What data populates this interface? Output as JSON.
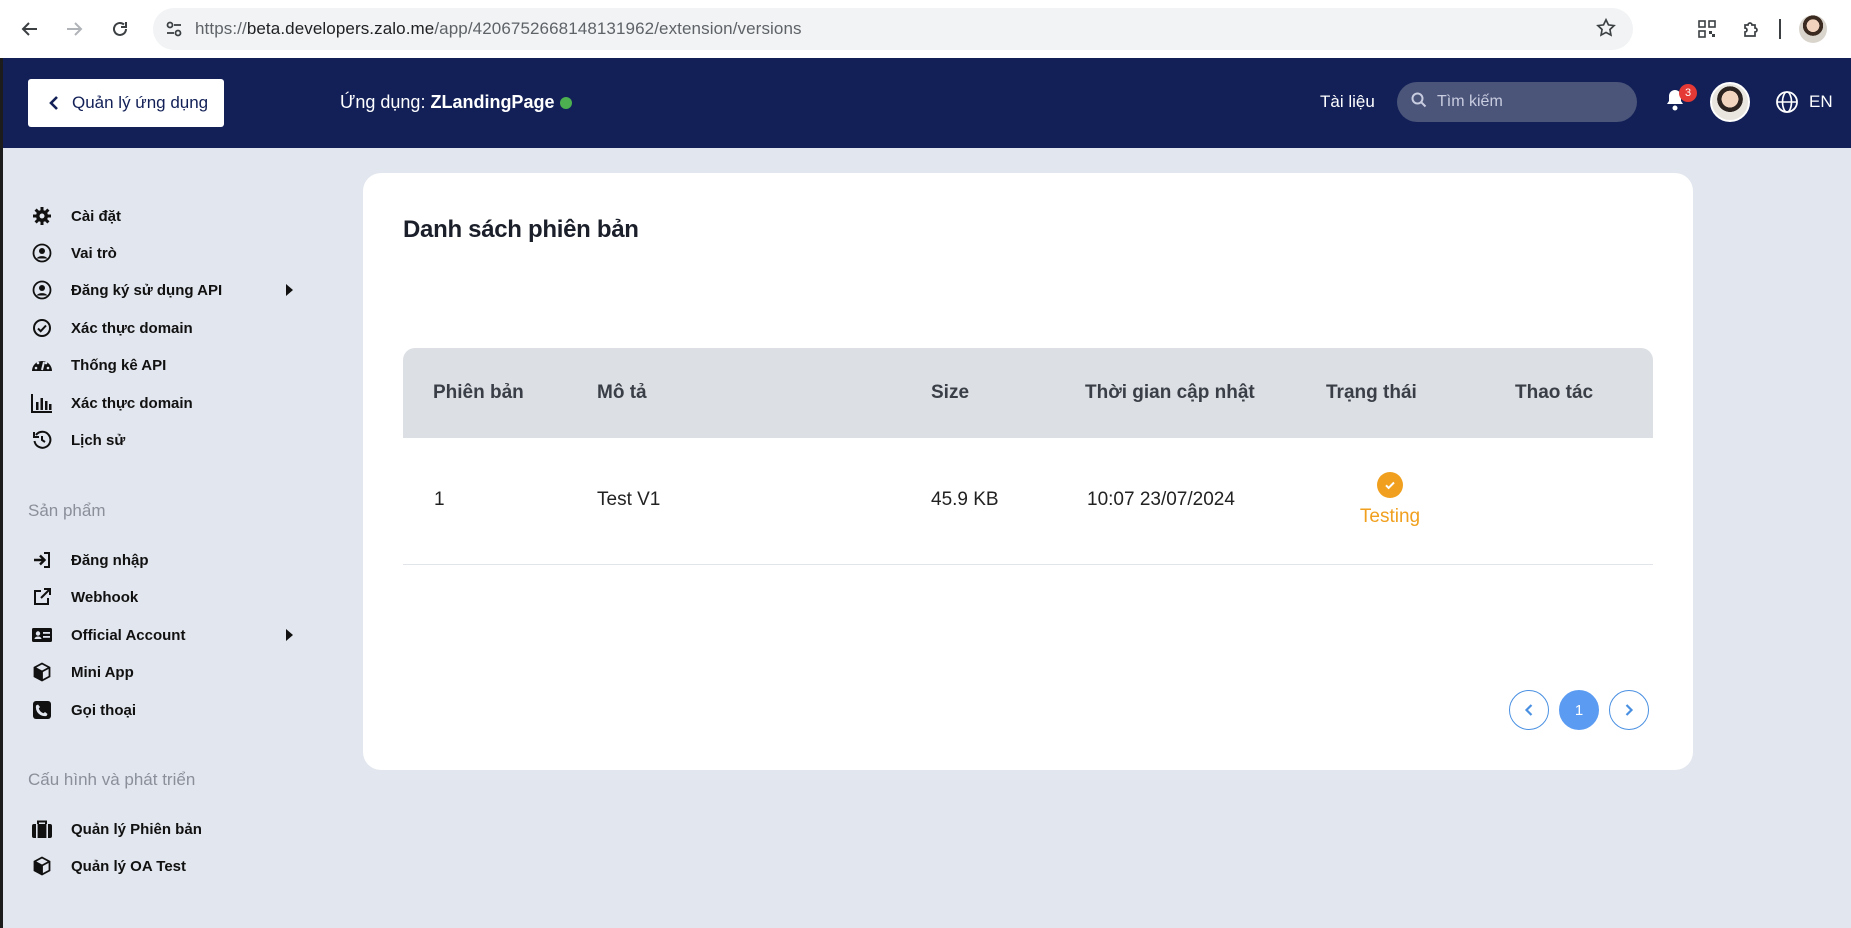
{
  "browser": {
    "url_prefix": "https://",
    "url_host": "beta.developers.zalo.me",
    "url_path": "/app/4206752668148131962/extension/versions"
  },
  "header": {
    "back_label": "Quản lý ứng dụng",
    "app_prefix": "Ứng dụng:",
    "app_name": "ZLandingPage",
    "app_status_color": "#4cb050",
    "docs_label": "Tài liệu",
    "search_placeholder": "Tìm kiếm",
    "notification_count": "3",
    "language": "EN"
  },
  "sidebar": {
    "items": [
      {
        "label": "Cài đặt",
        "icon": "gear-icon"
      },
      {
        "label": "Vai trò",
        "icon": "user-circle-icon"
      },
      {
        "label": "Đăng ký sử dụng API",
        "icon": "user-circle-icon"
      },
      {
        "label": "Xác thực domain",
        "icon": "check-circle-icon"
      },
      {
        "label": "Thống kê API",
        "icon": "gauge-icon"
      },
      {
        "label": "Xác thực domain",
        "icon": "bar-chart-icon"
      },
      {
        "label": "Lịch sử",
        "icon": "history-icon"
      }
    ],
    "section_products": "Sản phẩm",
    "product_items": [
      {
        "label": "Đăng nhập",
        "icon": "sign-in-icon"
      },
      {
        "label": "Webhook",
        "icon": "external-link-icon"
      },
      {
        "label": "Official Account",
        "icon": "id-card-icon"
      },
      {
        "label": "Mini App",
        "icon": "cube-icon"
      },
      {
        "label": "Gọi thoại",
        "icon": "phone-icon"
      }
    ],
    "section_config": "Cấu hình và phát triển",
    "config_items": [
      {
        "label": "Quản lý Phiên bản",
        "icon": "briefcase-icon"
      },
      {
        "label": "Quản lý OA Test",
        "icon": "cube-icon"
      }
    ]
  },
  "main": {
    "title": "Danh sách phiên bản",
    "columns": [
      "Phiên bản",
      "Mô tả",
      "Size",
      "Thời gian cập nhật",
      "Trạng thái",
      "Thao tác"
    ],
    "rows": [
      {
        "version": "1",
        "description": "Test V1",
        "size": "45.9 KB",
        "updated": "10:07 23/07/2024",
        "status": "Testing",
        "status_color": "#f0a01e"
      }
    ],
    "pagination": {
      "current_page": "1"
    }
  }
}
